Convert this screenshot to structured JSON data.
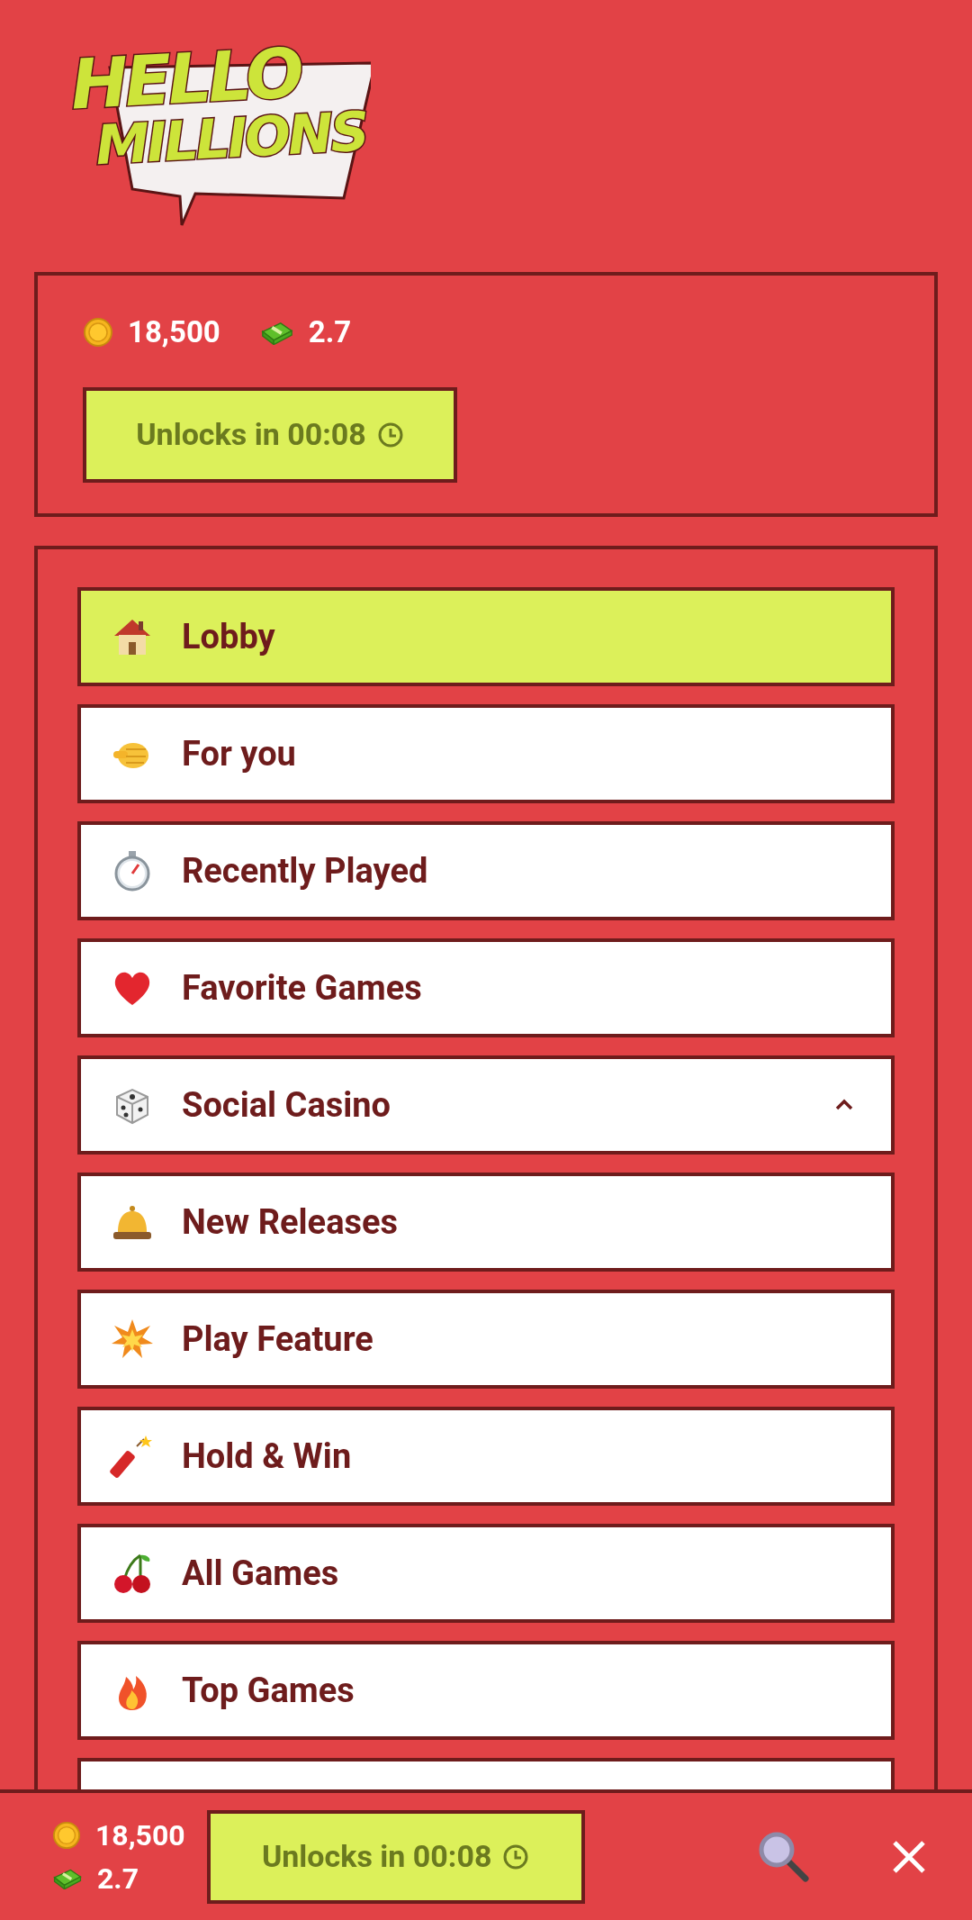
{
  "logo": {
    "lines": [
      "HELLO",
      "MILLIONS"
    ]
  },
  "balance": {
    "coins": "18,500",
    "cash": "2.7",
    "unlock_button": "Unlocks in 00:08"
  },
  "menu": [
    {
      "label": "Lobby",
      "selected": true,
      "kind": "link"
    },
    {
      "label": "For you",
      "selected": false,
      "kind": "link"
    },
    {
      "label": "Recently Played",
      "selected": false,
      "kind": "link"
    },
    {
      "label": "Favorite Games",
      "selected": false,
      "kind": "link"
    },
    {
      "label": "Social Casino",
      "selected": false,
      "kind": "group",
      "expanded": true
    },
    {
      "label": "New Releases",
      "selected": false,
      "kind": "link"
    },
    {
      "label": "Play Feature",
      "selected": false,
      "kind": "link"
    },
    {
      "label": "Hold & Win",
      "selected": false,
      "kind": "link"
    },
    {
      "label": "All Games",
      "selected": false,
      "kind": "link"
    },
    {
      "label": "Top Games",
      "selected": false,
      "kind": "link"
    }
  ],
  "bottom_bar": {
    "coins": "18,500",
    "cash": "2.7",
    "unlock_button": "Unlocks in 00:08"
  }
}
